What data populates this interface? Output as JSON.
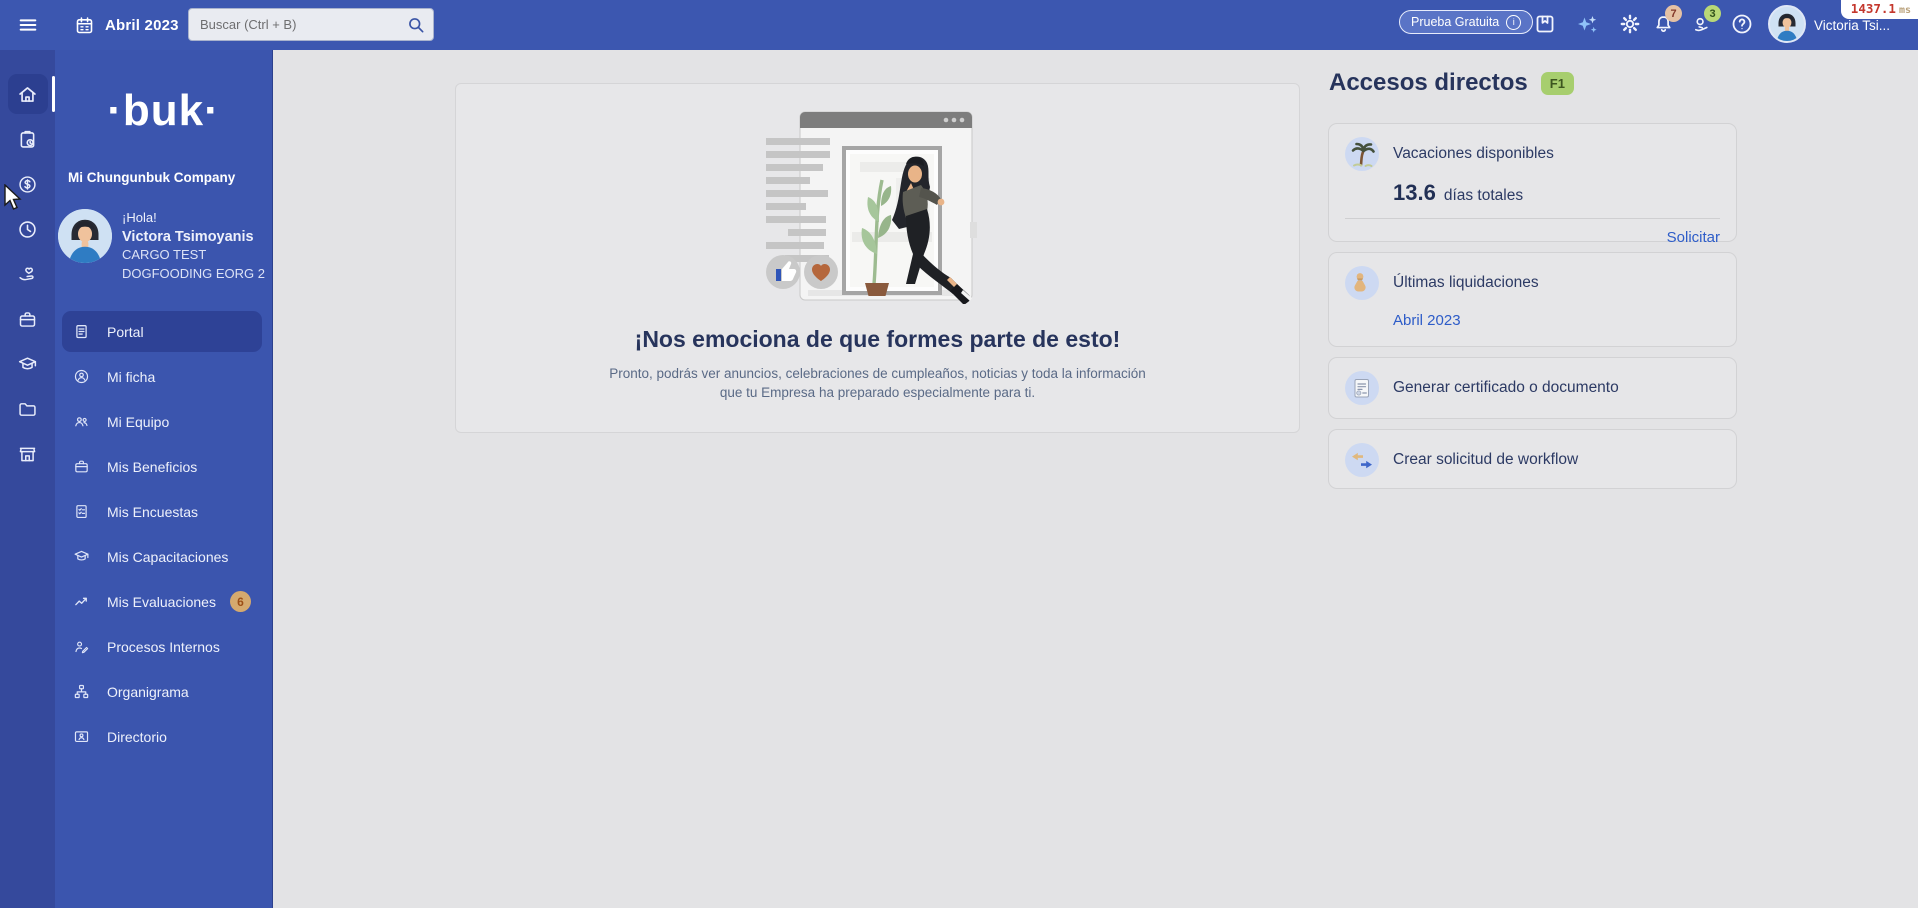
{
  "topbar": {
    "date_label": "Abril 2023",
    "search_placeholder": "Buscar (Ctrl + B)",
    "trial_label": "Prueba Gratuita",
    "bell_badge": "7",
    "rewards_badge": "3",
    "user_name_short": "Victoria Tsi...",
    "perf_value": "1437.1",
    "perf_unit": "ms"
  },
  "rail": {
    "items": [
      {
        "icon": "home-icon",
        "active": true
      },
      {
        "icon": "clipboard-clock-icon",
        "active": false
      },
      {
        "icon": "dollar-coin-icon",
        "active": false
      },
      {
        "icon": "clock-icon",
        "active": false
      },
      {
        "icon": "hand-heart-icon",
        "active": false
      },
      {
        "icon": "briefcase-icon",
        "active": false
      },
      {
        "icon": "graduation-cap-icon",
        "active": false
      },
      {
        "icon": "folder-icon",
        "active": false
      },
      {
        "icon": "storefront-icon",
        "active": false
      }
    ]
  },
  "sidebar": {
    "logo": "·buk·",
    "company": "Mi Chungunbuk Company",
    "greeting": "¡Hola!",
    "user_name": "Victora Tsimoyanis",
    "user_role_line1": "CARGO TEST",
    "user_role_line2": "DOGFOODING EORG 2",
    "items": [
      {
        "label": "Portal",
        "icon": "document-icon",
        "active": true
      },
      {
        "label": "Mi ficha",
        "icon": "person-circle-icon",
        "active": false
      },
      {
        "label": "Mi Equipo",
        "icon": "people-icon",
        "active": false
      },
      {
        "label": "Mis Beneficios",
        "icon": "briefcase-icon",
        "active": false
      },
      {
        "label": "Mis Encuestas",
        "icon": "survey-icon",
        "active": false
      },
      {
        "label": "Mis Capacitaciones",
        "icon": "graduation-cap-icon",
        "active": false
      },
      {
        "label": "Mis Evaluaciones",
        "icon": "trend-up-icon",
        "active": false,
        "badge": "6"
      },
      {
        "label": "Procesos Internos",
        "icon": "person-edit-icon",
        "active": false
      },
      {
        "label": "Organigrama",
        "icon": "org-chart-icon",
        "active": false
      },
      {
        "label": "Directorio",
        "icon": "contact-card-icon",
        "active": false
      }
    ]
  },
  "main": {
    "welcome_title": "¡Nos emociona de que formes parte de esto!",
    "welcome_sub": "Pronto, podrás ver anuncios, celebraciones de cumpleaños, noticias y toda la información que tu Empresa ha preparado especialmente para ti."
  },
  "shortcuts": {
    "title": "Accesos directos",
    "hotkey": "F1",
    "cards": [
      {
        "icon": "palm-tree-icon",
        "title": "Vacaciones disponibles",
        "value": "13.6",
        "value_suffix": "días totales",
        "action": "Solicitar"
      },
      {
        "icon": "money-bag-icon",
        "title": "Últimas liquidaciones",
        "link": "Abril 2023"
      },
      {
        "icon": "certificate-icon",
        "title": "Generar certificado o documento"
      },
      {
        "icon": "workflow-icon",
        "title": "Crear solicitud de workflow"
      }
    ]
  },
  "colors": {
    "topbar_blue": "#3c57b0",
    "rail_blue": "#35499c",
    "sidebar_blue": "#3b55ae",
    "active_item_blue": "#2e4296",
    "page_background": "#e3e3e5",
    "heading_navy": "#27345c",
    "link_blue": "#2d5cc8",
    "hotkey_green": "#a7ce6e",
    "bell_badge_tan": "#e5c1a4",
    "rewards_badge_green": "#b9d877",
    "eval_badge_tan": "#d5a96e"
  }
}
